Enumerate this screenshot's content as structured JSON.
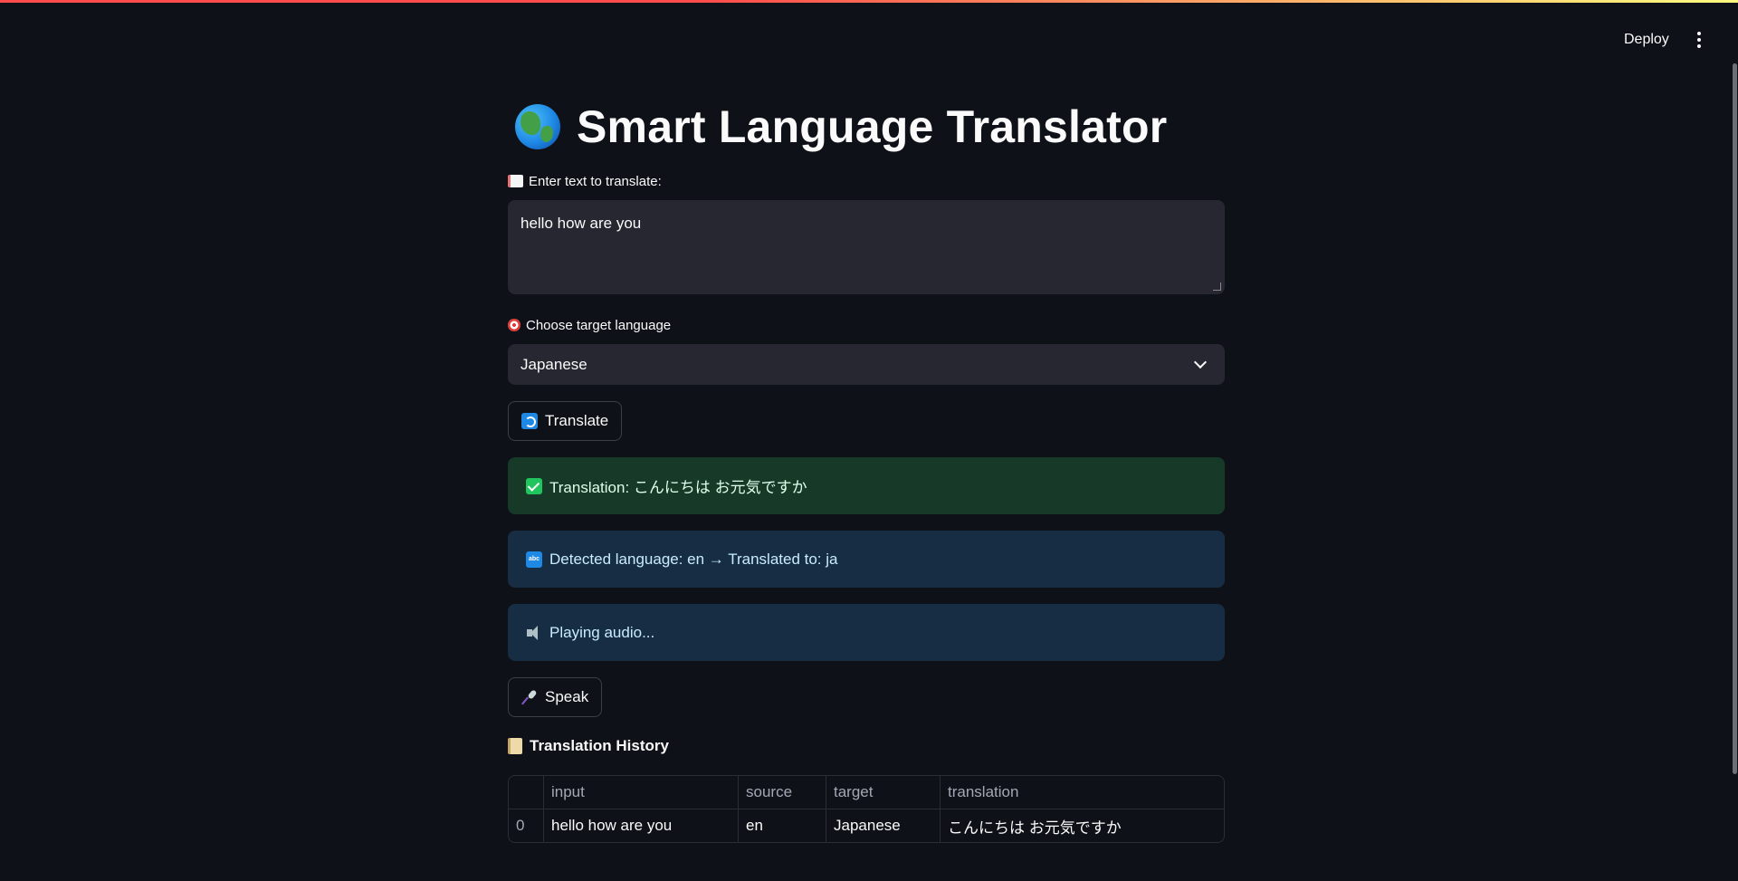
{
  "header": {
    "deploy_label": "Deploy",
    "menu_icon": "kebab-menu-icon"
  },
  "main": {
    "title": "Smart Language Translator",
    "title_icon": "globe-icon",
    "input_label": "Enter text to translate:",
    "input_value": "hello how are you",
    "language_label": "Choose target language",
    "language_selected": "Japanese",
    "translate_button": "Translate",
    "success_message": "Translation: こんにちは お元気ですか",
    "detected_message": "Detected language: en → Translated to: ja",
    "audio_message": "Playing audio...",
    "speak_button": "Speak",
    "history_title": "Translation History"
  },
  "history_table": {
    "columns": [
      "",
      "input",
      "source",
      "target",
      "translation"
    ],
    "rows": [
      {
        "index": "0",
        "input": "hello how are you",
        "source": "en",
        "target": "Japanese",
        "translation": "こんにちは お元気ですか"
      }
    ]
  },
  "colors": {
    "background": "#0e1117",
    "success_bg": "#173928",
    "info_bg": "#172d43",
    "input_bg": "#262730"
  }
}
